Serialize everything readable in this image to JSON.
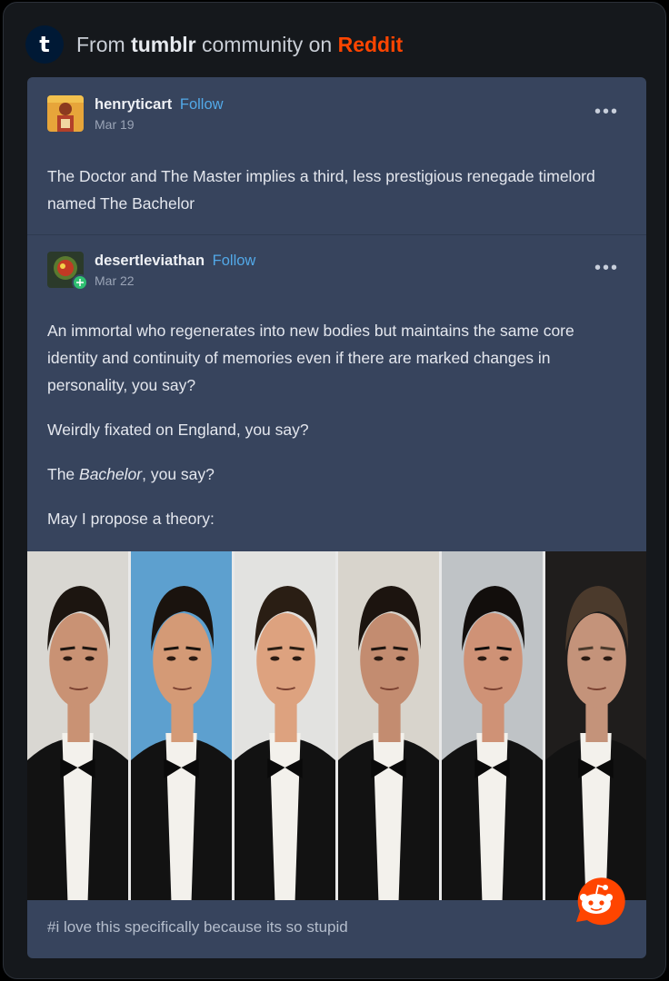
{
  "header": {
    "prefix": "From",
    "source": "tumblr",
    "middle": "community on",
    "platform": "Reddit"
  },
  "posts": [
    {
      "username": "henryticart",
      "follow_label": "Follow",
      "date": "Mar 19",
      "more_label": "•••",
      "paragraphs": [
        "The Doctor and The Master implies a third, less prestigious renegade timelord named The Bachelor"
      ]
    },
    {
      "username": "desertleviathan",
      "follow_label": "Follow",
      "date": "Mar 22",
      "more_label": "•••",
      "paragraphs": [
        "An immortal who regenerates into new bodies but maintains the same core identity and continuity of memories even if there are marked changes in personality, you say?",
        "Weirdly fixated on England, you say?"
      ],
      "bachelor_prefix": "The ",
      "bachelor_italic": "Bachelor",
      "bachelor_suffix": ", you say?",
      "last_paragraph": "May I propose a theory:"
    }
  ],
  "photos": [
    {
      "name": "photo-1",
      "bg": "#d9d7d2",
      "skin": "#c99274",
      "hair": "#1c1510"
    },
    {
      "name": "photo-2",
      "bg": "#5da0cf",
      "skin": "#d49a76",
      "hair": "#1a130e"
    },
    {
      "name": "photo-3",
      "bg": "#e2e2e0",
      "skin": "#dda27f",
      "hair": "#2a1e14"
    },
    {
      "name": "photo-4",
      "bg": "#d8d4cc",
      "skin": "#c38c70",
      "hair": "#1c140f"
    },
    {
      "name": "photo-5",
      "bg": "#bfc3c6",
      "skin": "#cf9276",
      "hair": "#120e0c"
    },
    {
      "name": "photo-6",
      "bg": "#1f1d1c",
      "skin": "#c4937a",
      "hair": "#4b3a2c"
    }
  ],
  "tags": "#i love this specifically because its so stupid",
  "colors": {
    "background": "#15181c",
    "card": "#37445d",
    "follow": "#52a9e8",
    "reddit": "#ff4500"
  }
}
